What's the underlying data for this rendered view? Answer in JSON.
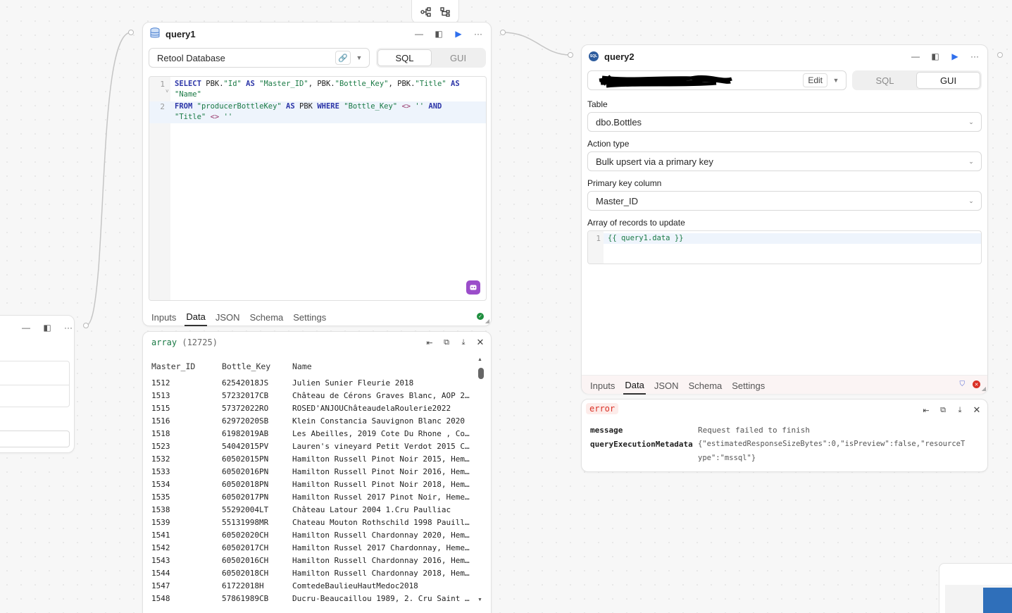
{
  "toolbar": {
    "icons": [
      "graph-view-icon",
      "tree-view-icon"
    ]
  },
  "query1": {
    "name": "query1",
    "resource": "Retool Database",
    "mode_sql": "SQL",
    "mode_gui": "GUI",
    "code_lines": [
      {
        "n": "1",
        "segments": [
          {
            "t": "SELECT",
            "c": "kw"
          },
          {
            "t": " PBK.",
            "c": ""
          },
          {
            "t": "\"Id\"",
            "c": "str"
          },
          {
            "t": " AS ",
            "c": "kw"
          },
          {
            "t": "\"Master_ID\"",
            "c": "str"
          },
          {
            "t": ", PBK.",
            "c": ""
          },
          {
            "t": "\"Bottle_Key\"",
            "c": "str"
          },
          {
            "t": ", PBK.",
            "c": ""
          },
          {
            "t": "\"Title\"",
            "c": "str"
          },
          {
            "t": " AS",
            "c": "kw"
          }
        ],
        "wrap": [
          {
            "t": "\"Name\"",
            "c": "str"
          }
        ]
      },
      {
        "n": "2",
        "segments": [
          {
            "t": "FROM",
            "c": "kw"
          },
          {
            "t": " ",
            "c": ""
          },
          {
            "t": "\"producerBottleKey\"",
            "c": "str"
          },
          {
            "t": " AS ",
            "c": "kw"
          },
          {
            "t": "PBK ",
            "c": ""
          },
          {
            "t": "WHERE",
            "c": "kw"
          },
          {
            "t": " ",
            "c": ""
          },
          {
            "t": "\"Bottle_Key\"",
            "c": "str"
          },
          {
            "t": " <> ",
            "c": "op"
          },
          {
            "t": "''",
            "c": "str"
          },
          {
            "t": " AND",
            "c": "kw"
          }
        ],
        "wrap": [
          {
            "t": "\"Title\"",
            "c": "str"
          },
          {
            "t": " <> ",
            "c": "op"
          },
          {
            "t": "''",
            "c": "str"
          }
        ]
      }
    ],
    "tabs": [
      "Inputs",
      "Data",
      "JSON",
      "Schema",
      "Settings"
    ],
    "active_tab": "Data"
  },
  "results": {
    "type_label": "array",
    "count": "(12725)",
    "columns": [
      "Master_ID",
      "Bottle_Key",
      "Name"
    ],
    "rows": [
      [
        "1512",
        "62542018JS",
        "Julien Sunier Fleurie 2018"
      ],
      [
        "1513",
        "57232017CB",
        "Château de Cérons Graves Blanc, AOP 2…"
      ],
      [
        "1515",
        "57372022RO",
        "ROSED'ANJOUChâteaudelaRoulerie2022"
      ],
      [
        "1516",
        "62972020SB",
        "Klein Constancia Sauvignon Blanc 2020"
      ],
      [
        "1518",
        "61982019AB",
        "Les Abeilles, 2019 Cote Du Rhone , Co…"
      ],
      [
        "1523",
        "54042015PV",
        "Lauren's vineyard Petit Verdot 2015 C…"
      ],
      [
        "1532",
        "60502015PN",
        "Hamilton Russell Pinot Noir 2015, Hem…"
      ],
      [
        "1533",
        "60502016PN",
        "Hamilton Russell Pinot Noir 2016, Hem…"
      ],
      [
        "1534",
        "60502018PN",
        "Hamilton Russell Pinot Noir 2018, Hem…"
      ],
      [
        "1535",
        "60502017PN",
        "Hamilton Russel 2017 Pinot Noir, Heme…"
      ],
      [
        "1538",
        "55292004LT",
        "Château Latour 2004 1.Cru Paulliac"
      ],
      [
        "1539",
        "55131998MR",
        "Chateau Mouton Rothschild 1998 Pauill…"
      ],
      [
        "1541",
        "60502020CH",
        "Hamilton Russell Chardonnay 2020, Hem…"
      ],
      [
        "1542",
        "60502017CH",
        "Hamilton Russel 2017 Chardonnay, Heme…"
      ],
      [
        "1543",
        "60502016CH",
        "Hamilton Russell Chardonnay 2016, Hem…"
      ],
      [
        "1544",
        "60502018CH",
        "Hamilton Russell Chardonnay 2018, Hem…"
      ],
      [
        "1547",
        "61722018H",
        "ComtedeBaulieuHautMedoc2018"
      ],
      [
        "1548",
        "57861989CB",
        "Ducru-Beaucaillou 1989, 2. Cru Saint …"
      ]
    ]
  },
  "query2": {
    "name": "query2",
    "edit_label": "Edit",
    "mode_sql": "SQL",
    "mode_gui": "GUI",
    "table_label": "Table",
    "table_value": "dbo.Bottles",
    "action_label": "Action type",
    "action_value": "Bulk upsert via a primary key",
    "pk_label": "Primary key column",
    "pk_value": "Master_ID",
    "records_label": "Array of records to update",
    "records_line_no": "1",
    "records_code": "{{ query1.data }}",
    "tabs": [
      "Inputs",
      "Data",
      "JSON",
      "Schema",
      "Settings"
    ],
    "active_tab": "Data"
  },
  "error_panel": {
    "badge": "error",
    "message_key": "message",
    "message_value": "Request failed to finish",
    "meta_key": "queryExecutionMetadata",
    "meta_value_1": "{\"estimatedResponseSizeBytes\":0,\"isPreview\":false,\"resourceT",
    "meta_value_2": "ype\":\"mssql\"}"
  },
  "colors": {
    "accent": "#2f6fed",
    "error": "#d93025",
    "success": "#1e8e3e",
    "ai_button": "#9b4dca"
  }
}
